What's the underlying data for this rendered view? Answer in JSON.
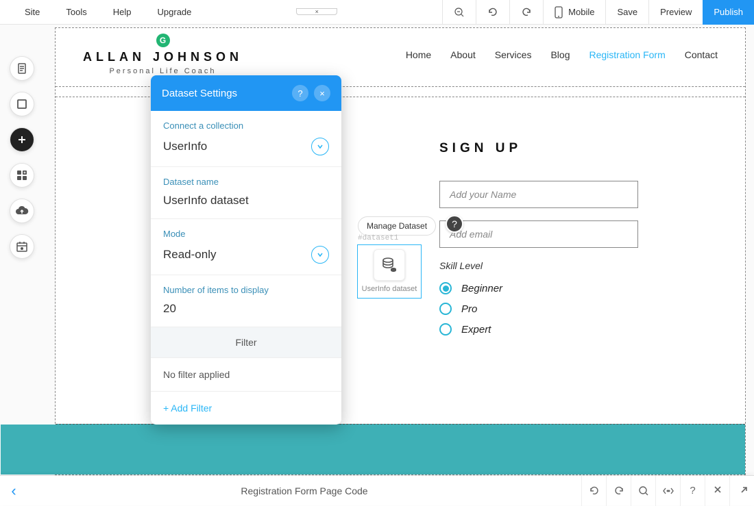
{
  "top_menu": {
    "left": [
      "Site",
      "Tools",
      "Help",
      "Upgrade"
    ],
    "zoom_out": "−",
    "mobile": "Mobile",
    "save": "Save",
    "preview": "Preview",
    "publish": "Publish",
    "tiny_tab": "×"
  },
  "site": {
    "badge": "G",
    "name": "ALLAN JOHNSON",
    "tagline": "Personal Life Coach",
    "nav": [
      "Home",
      "About",
      "Services",
      "Blog",
      "Registration Form",
      "Contact"
    ],
    "nav_active_index": 4
  },
  "signup": {
    "title": "SIGN UP",
    "name_placeholder": "Add your Name",
    "email_placeholder": "Add email",
    "skill_label": "Skill Level",
    "options": [
      "Beginner",
      "Pro",
      "Expert"
    ],
    "selected_index": 0
  },
  "dataset_el": {
    "manage": "Manage Dataset",
    "id": "#dataset1",
    "name": "UserInfo dataset",
    "help": "?"
  },
  "panel": {
    "title": "Dataset Settings",
    "help": "?",
    "close": "×",
    "connect_label": "Connect a collection",
    "connect_value": "UserInfo",
    "name_label": "Dataset name",
    "name_value": "UserInfo dataset",
    "mode_label": "Mode",
    "mode_value": "Read-only",
    "items_label": "Number of items to display",
    "items_value": "20",
    "filter_header": "Filter",
    "filter_status": "No filter applied",
    "add_filter": "+ Add Filter"
  },
  "bottom": {
    "back": "‹",
    "title": "Registration Form Page Code",
    "tools": [
      "undo",
      "redo",
      "search",
      "code",
      "help",
      "expand",
      "popout"
    ]
  }
}
